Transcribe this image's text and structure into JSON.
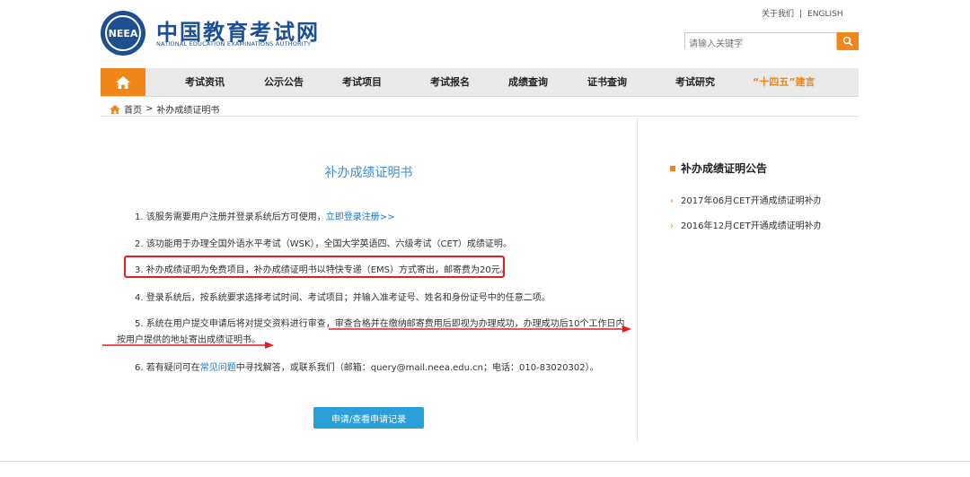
{
  "header": {
    "logo_badge": "NEEA",
    "title": "中国教育考试网",
    "subtitle": "NATIONAL EDUCATION EXAMINATIONS AUTHORITY",
    "about": "关于我们",
    "separator": "|",
    "english": "ENGLISH",
    "search_placeholder": "请输入关键字"
  },
  "nav": {
    "items": [
      "考试资讯",
      "公示公告",
      "考试项目",
      "考试报名",
      "成绩查询",
      "证书查询",
      "考试研究",
      "“十四五”建言"
    ]
  },
  "breadcrumb": {
    "home": "首页",
    "sep": ">",
    "current": "补办成绩证明书"
  },
  "main": {
    "title": "补办成绩证明书",
    "item1_text": "1. 该服务需要用户注册并登录系统后方可使用，",
    "item1_link": "立即登录注册>>",
    "item2": "2. 该功能用于办理全国外语水平考试（WSK），全国大学英语四、六级考试（CET）成绩证明。",
    "item3": "3. 补办成绩证明为免费项目，补办成绩证明书以特快专递（EMS）方式寄出，邮寄费为20元。",
    "item4": "4. 登录系统后，按系统要求选择考试时间、考试项目；并输入准考证号、姓名和身份证号中的任意二项。",
    "item5_line1": "5. 系统在用户提交申请后将对提交资料进行审查，审查合格并在缴纳邮寄费用后即视为办理成功，办理成功后10个工作日内",
    "item5_line2": "按用户提供的地址寄出成绩证明书。",
    "item6_pre": "6. 若有疑问可在",
    "item6_link": "常见问题",
    "item6_post": "中寻找解答，或联系我们（邮箱：query@mail.neea.edu.cn；电话：010-83020302）。",
    "apply_button": "申请/查看申请记录"
  },
  "sidebar": {
    "title": "补办成绩证明公告",
    "items": [
      "2017年06月CET开通成绩证明补办",
      "2016年12月CET开通成绩证明补办"
    ]
  },
  "colors": {
    "brand_blue": "#1d4f91",
    "accent_orange": "#f08519",
    "link_blue": "#1a75c3",
    "annotation_red": "#e51c23"
  }
}
